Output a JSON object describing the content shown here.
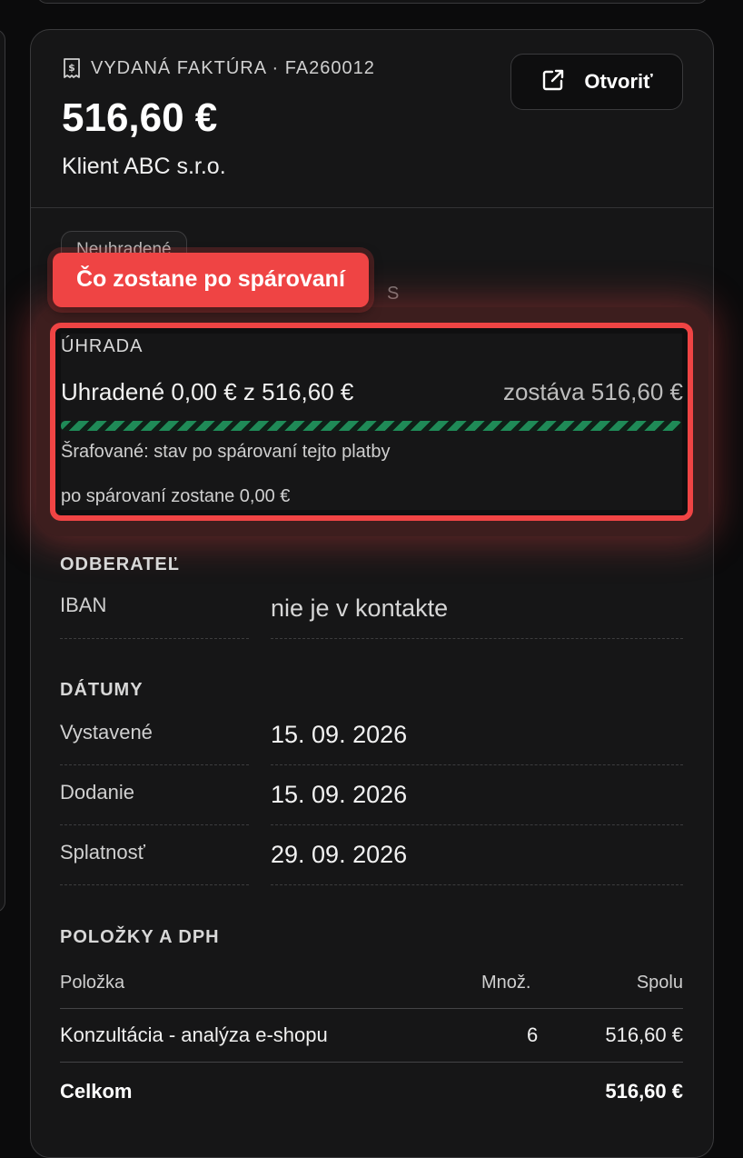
{
  "header": {
    "doc_type": "VYDANÁ FAKTÚRA · FA260012",
    "amount": "516,60 €",
    "client": "Klient ABC s.r.o.",
    "open_label": "Otvoriť"
  },
  "status": {
    "badge": "Neuhradené",
    "ghost": "S"
  },
  "tooltip": {
    "label": "Čo zostane po spárovaní"
  },
  "payment": {
    "title": "ÚHRADA",
    "paid_text": "Uhradené 0,00 € z 516,60 €",
    "remaining_text": "zostáva 516,60 €",
    "progress_paid": 0,
    "progress_after_match": 1.0,
    "note": "Šrafované: stav po spárovaní tejto platby",
    "after_match": "po spárovaní zostane 0,00 €",
    "colors": {
      "accent": "#ef4444",
      "progress": "#1f8a57"
    }
  },
  "customer": {
    "title": "ODBERATEĽ",
    "iban_label": "IBAN",
    "iban_value": "nie je v kontakte"
  },
  "dates": {
    "title": "DÁTUMY",
    "issued_label": "Vystavené",
    "issued_value": "15. 09. 2026",
    "delivery_label": "Dodanie",
    "delivery_value": "15. 09. 2026",
    "due_label": "Splatnosť",
    "due_value": "29. 09. 2026"
  },
  "items": {
    "title": "POLOŽKY A DPH",
    "col_item": "Položka",
    "col_qty": "Množ.",
    "col_total": "Spolu",
    "rows": [
      {
        "name": "Konzultácia - analýza e-shopu",
        "qty": "6",
        "total": "516,60 €"
      }
    ],
    "sum_label": "Celkom",
    "sum_value": "516,60 €"
  },
  "icons": {
    "doc": "receipt-icon",
    "open": "external-link-icon"
  }
}
